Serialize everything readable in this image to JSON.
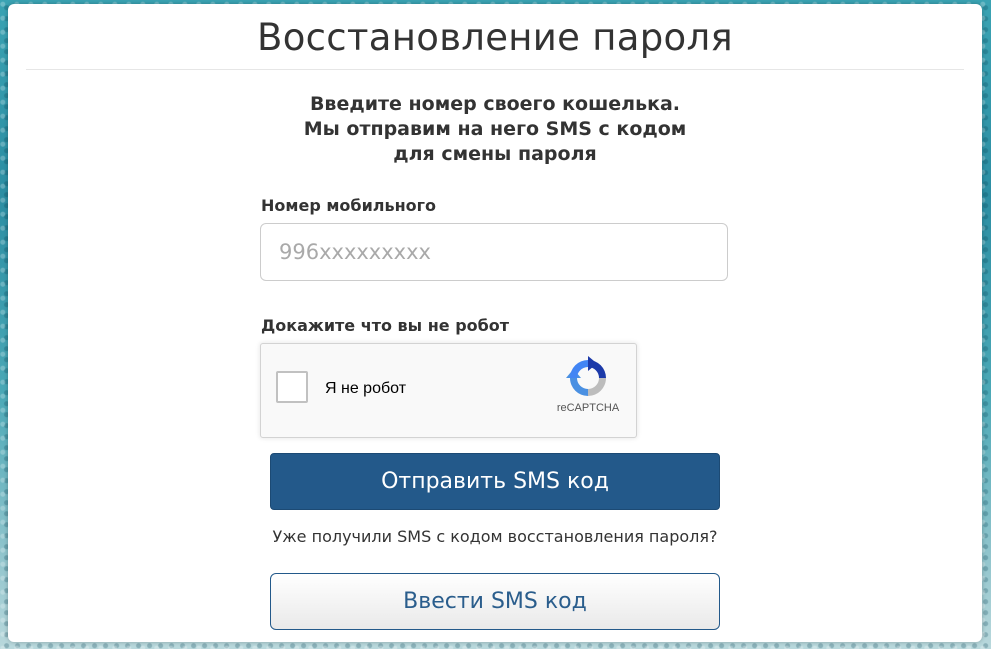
{
  "page": {
    "title": "Восстановление пароля"
  },
  "instructions": {
    "line1": "Введите номер своего кошелька.",
    "line2": "Мы отправим на него SMS с кодом",
    "line3": "для смены пароля"
  },
  "phone": {
    "label": "Номер мобильного",
    "placeholder": "996xxxxxxxxx",
    "value": ""
  },
  "captcha": {
    "label": "Докажите что вы не робот",
    "checkbox_label": "Я не робот",
    "brand": "reCAPTCHA",
    "checked": false
  },
  "actions": {
    "send_label": "Отправить SMS код",
    "question": "Уже получили SMS с кодом восстановления пароля?",
    "enter_label": "Ввести SMS код"
  },
  "colors": {
    "primary": "#23598a",
    "text": "#333333",
    "border": "#cccccc"
  },
  "icons": {
    "captcha_logo": "recaptcha-logo-icon"
  }
}
